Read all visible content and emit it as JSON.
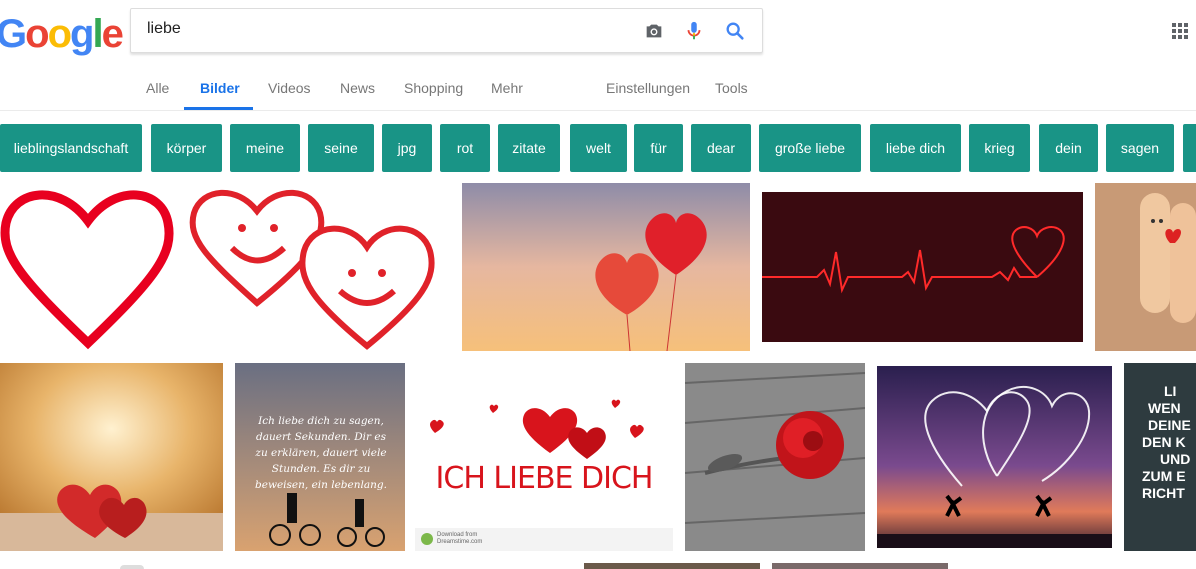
{
  "logo": {
    "letters": [
      "G",
      "o",
      "o",
      "g",
      "l",
      "e"
    ],
    "colors": [
      "#4285F4",
      "#EA4335",
      "#FBBC05",
      "#4285F4",
      "#34A853",
      "#EA4335"
    ]
  },
  "search": {
    "value": "liebe"
  },
  "tabs": [
    {
      "label": "Alle"
    },
    {
      "label": "Bilder"
    },
    {
      "label": "Videos"
    },
    {
      "label": "News"
    },
    {
      "label": "Shopping"
    },
    {
      "label": "Mehr"
    },
    {
      "label": "Einstellungen"
    },
    {
      "label": "Tools"
    }
  ],
  "chips": [
    "lieblingslandschaft",
    "körper",
    "meine",
    "seine",
    "jpg",
    "rot",
    "zitate",
    "welt",
    "für",
    "dear",
    "große liebe",
    "liebe dich",
    "krieg",
    "dein",
    "sagen"
  ],
  "results": {
    "quote_lines": [
      "Ich liebe dich zu sagen,",
      "dauert Sekunden. Dir es",
      "zu erklären, dauert viele",
      "Stunden. Es dir zu",
      "beweisen, ein lebenlang."
    ],
    "ich_liebe_dich": "ICH LIEBE DICH",
    "stock_watermark_line1": "Download from",
    "stock_watermark_line2": "Dreamstime.com",
    "partial_text_lines": [
      "LI",
      "WEN",
      "DEINE",
      "DEN K",
      "UND",
      "ZUM E",
      "RICHT"
    ]
  },
  "colors": {
    "accent": "#1a73e8",
    "chip_bg": "#199486"
  }
}
